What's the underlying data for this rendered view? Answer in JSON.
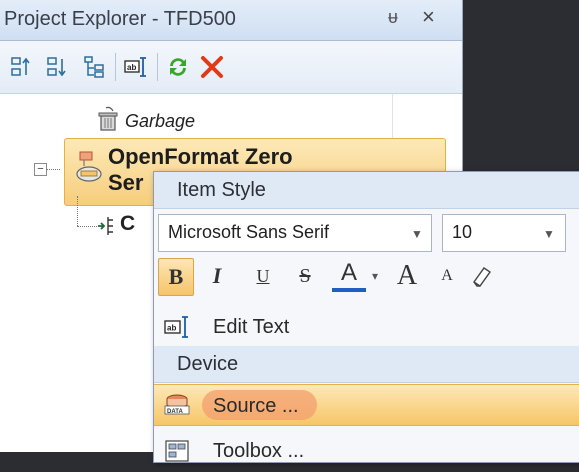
{
  "panel": {
    "title": "Project Explorer - TFD500",
    "pin_glyph": "ᵾ",
    "close_glyph": "×"
  },
  "tree": {
    "garbage_label": "Garbage",
    "selected_node_line1": "OpenFormat Zero",
    "selected_node_line2": "Ser",
    "child_label": "C",
    "expander_glyph": "−"
  },
  "context_menu": {
    "item_style_header": "Item Style",
    "font_family_value": "Microsoft Sans Serif",
    "font_size_value": "10",
    "format_buttons": {
      "bold": "B",
      "italic": "I",
      "underline": "U",
      "strikethrough": "S",
      "font_color": "A",
      "grow_font": "A",
      "shrink_font": "A"
    },
    "edit_text_label": "Edit Text",
    "device_header": "Device",
    "source_label": "Source ...",
    "toolbox_label": "Toolbox ..."
  },
  "colors": {
    "accent_highlight": "#f6c668",
    "delete_red": "#e23a16",
    "refresh_green": "#3aa52b",
    "font_color_underline": "#1f5fbf"
  }
}
